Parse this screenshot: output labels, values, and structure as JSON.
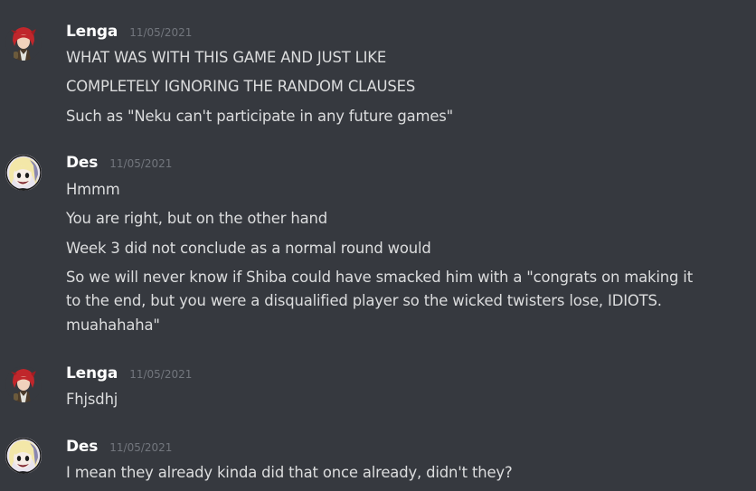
{
  "colors": {
    "background": "#36393f",
    "username": "#ffffff",
    "timestamp": "#72767d",
    "message_text": "#dcddde"
  },
  "messages": [
    {
      "username": "Lenga",
      "timestamp": "11/05/2021",
      "avatar_icon": "red-haired-character-avatar",
      "lines": [
        "WHAT WAS WITH THIS GAME AND JUST LIKE",
        "COMPLETELY IGNORING THE RANDOM CLAUSES",
        "Such as \"Neku can't participate in any future games\""
      ]
    },
    {
      "username": "Des",
      "timestamp": "11/05/2021",
      "avatar_icon": "blonde-character-avatar",
      "lines": [
        "Hmmm",
        "You are right, but on the other hand",
        "Week 3 did not conclude as a normal round would",
        "So we will never know if Shiba could have smacked him with a \"congrats on making it",
        "to the end, but you were a disqualified player so the wicked twisters lose, IDIOTS.",
        "muahahaha\""
      ]
    },
    {
      "username": "Lenga",
      "timestamp": "11/05/2021",
      "avatar_icon": "red-haired-character-avatar",
      "lines": [
        "Fhjsdhj"
      ]
    },
    {
      "username": "Des",
      "timestamp": "11/05/2021",
      "avatar_icon": "blonde-character-avatar",
      "lines": [
        "I mean they already kinda did that once already, didn't they?"
      ]
    }
  ]
}
